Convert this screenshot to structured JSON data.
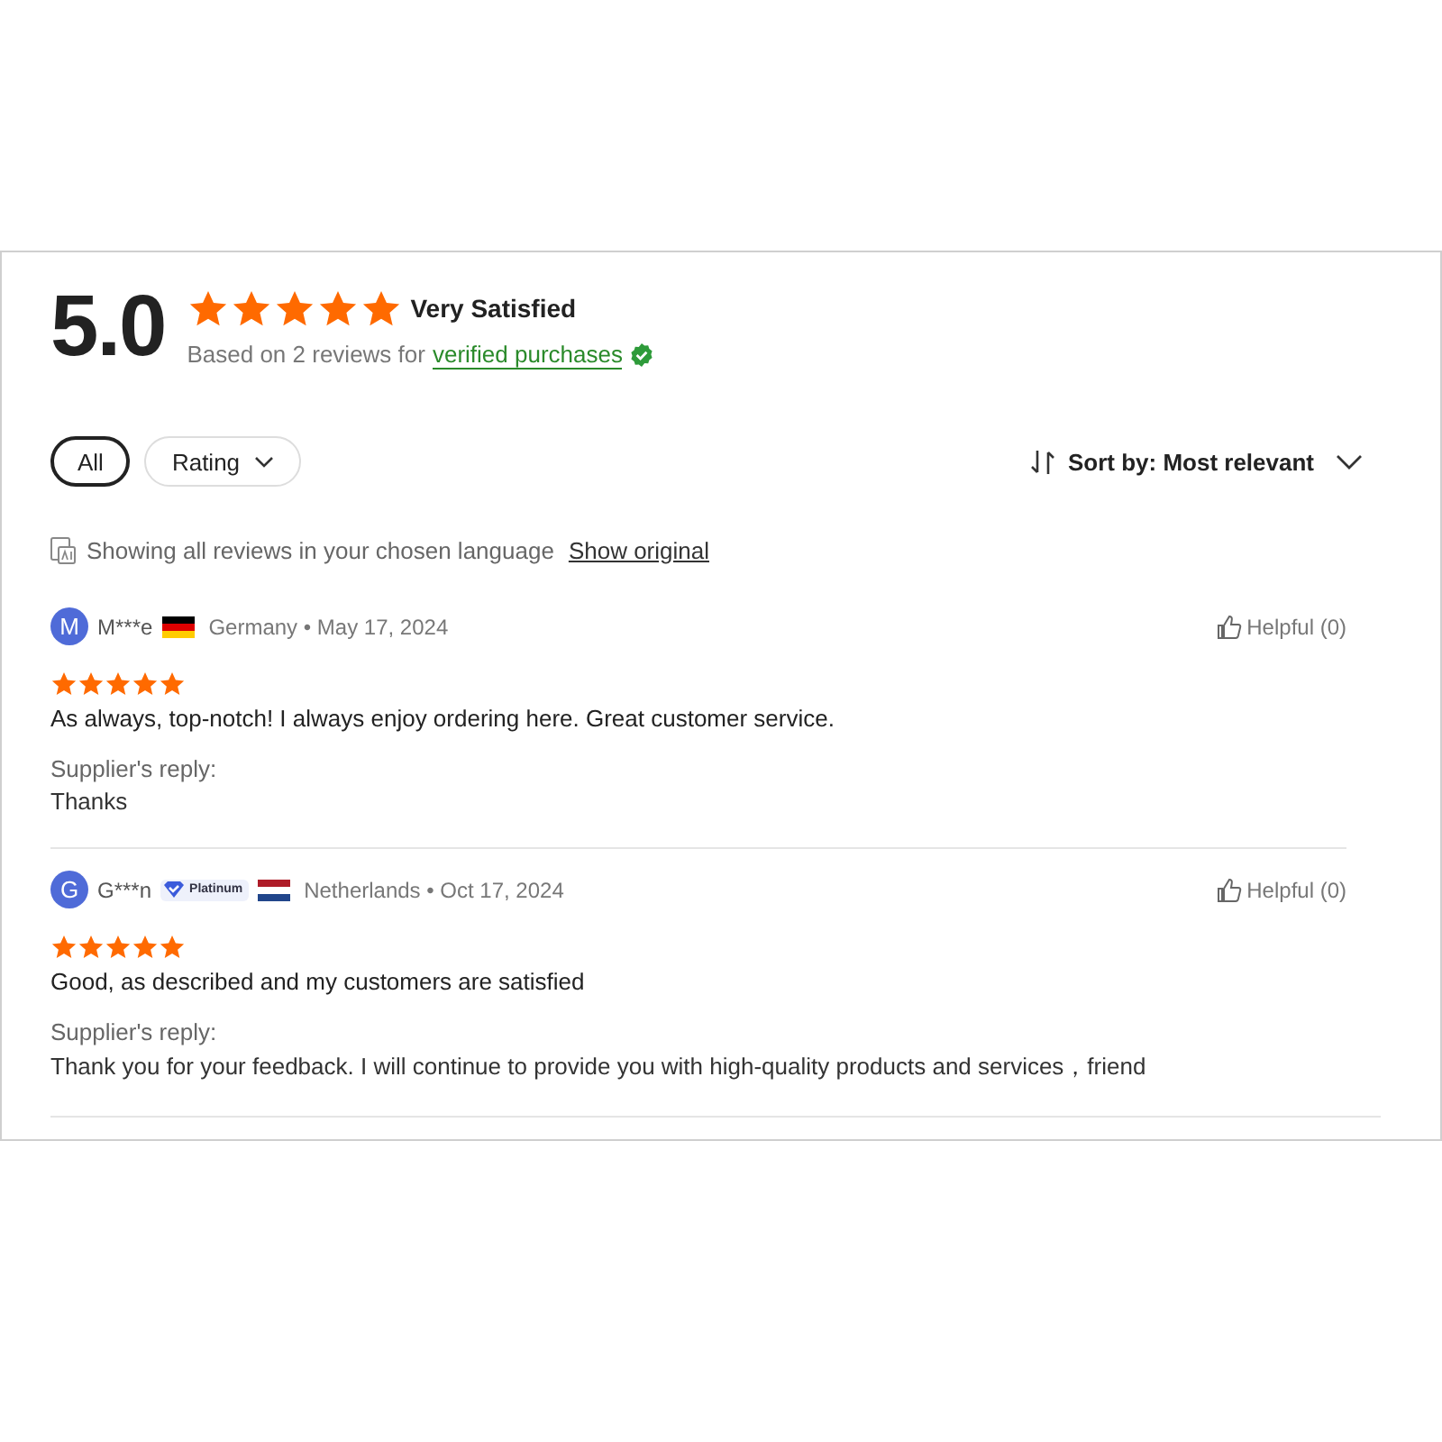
{
  "summary": {
    "score": "5.0",
    "stars": 5,
    "label": "Very Satisfied",
    "based_on": "Based on 2 reviews for",
    "verified_link": "verified purchases"
  },
  "filters": [
    {
      "label": "All",
      "selected": true
    },
    {
      "label": "Rating",
      "selected": false,
      "dropdown": true
    }
  ],
  "sort": {
    "label": "Sort by: Most relevant"
  },
  "language_notice": {
    "text": "Showing all reviews in your chosen language",
    "link": "Show original"
  },
  "reviews": [
    {
      "avatar": "M",
      "name": "M***e",
      "flag": {
        "kind": "germany"
      },
      "meta": "Germany • May 17, 2024",
      "helpful": "Helpful (0)",
      "stars": 5,
      "text": "As always, top-notch! I always enjoy ordering here. Great customer service.",
      "reply_label": "Supplier's reply:",
      "reply": "Thanks"
    },
    {
      "avatar": "G",
      "name": "G***n",
      "badge": "Platinum",
      "flag": {
        "kind": "netherlands"
      },
      "meta": "Netherlands • Oct 17, 2024",
      "helpful": "Helpful (0)",
      "stars": 5,
      "text": "Good, as described and my customers are satisfied",
      "reply_label": "Supplier's reply:",
      "reply": "Thank you for your feedback. I will continue to provide you with high-quality products and services，friend"
    }
  ]
}
